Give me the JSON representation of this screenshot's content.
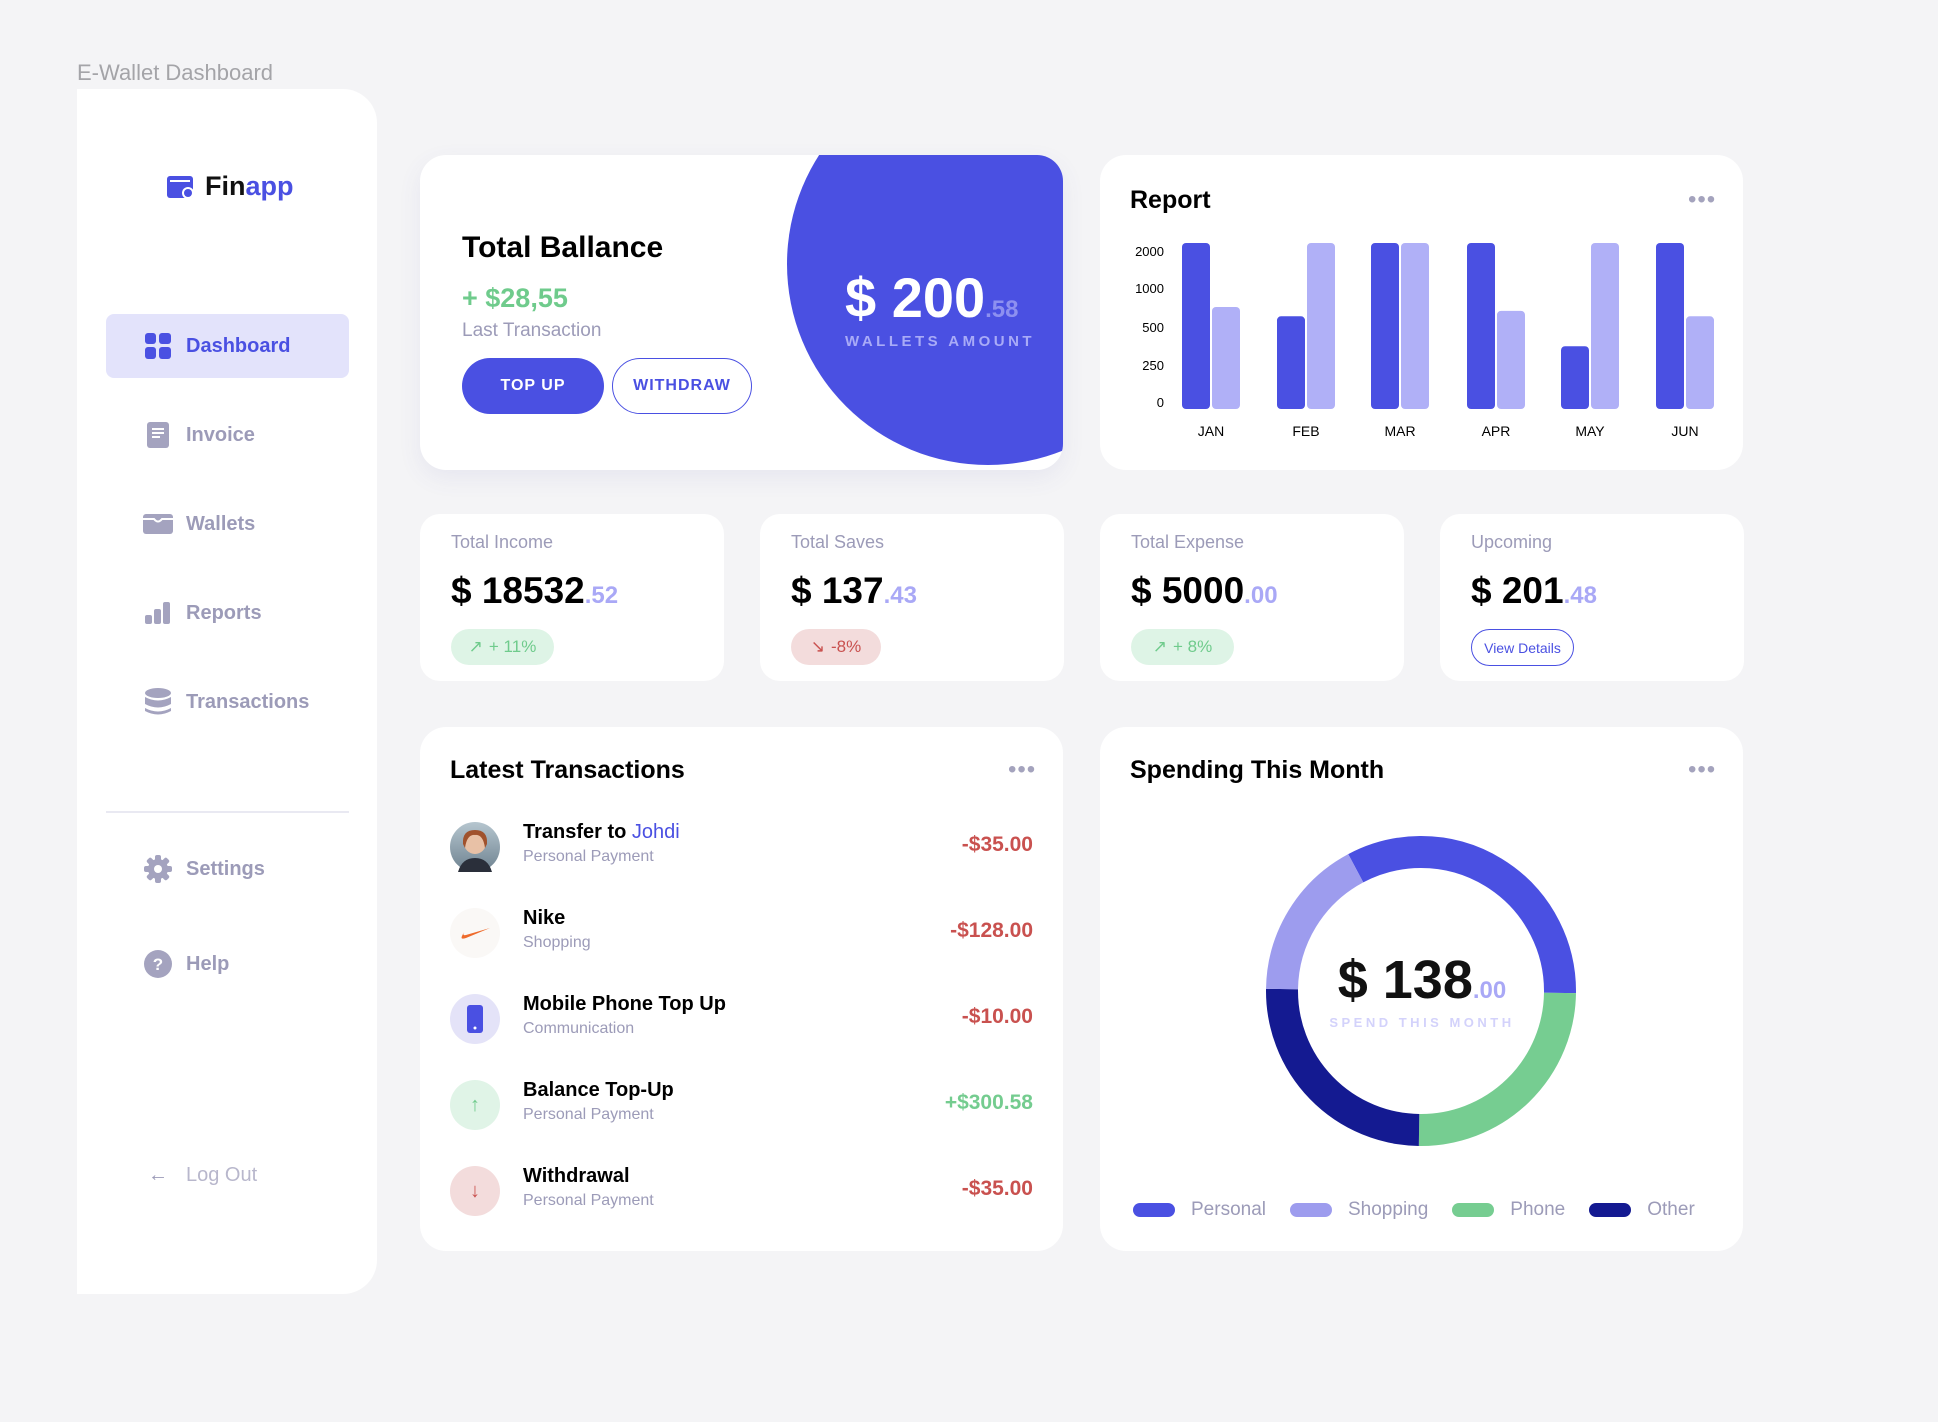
{
  "page_title": "E-Wallet Dashboard",
  "colors": {
    "primary": "#4a50e2",
    "light": "#b0b0f7",
    "green": "#74cc8f",
    "red": "#c9514f",
    "navy": "#141a91",
    "lavender": "#9d9cee"
  },
  "sidebar": {
    "logo": {
      "part1": "Fin",
      "part2": "app"
    },
    "items": [
      {
        "label": "Dashboard",
        "icon": "grid-icon",
        "active": true
      },
      {
        "label": "Invoice",
        "icon": "document-icon"
      },
      {
        "label": "Wallets",
        "icon": "wallet-icon"
      },
      {
        "label": "Reports",
        "icon": "bar-chart-icon"
      },
      {
        "label": "Transactions",
        "icon": "database-icon"
      }
    ],
    "bottom": [
      {
        "label": "Settings",
        "icon": "gear-icon"
      },
      {
        "label": "Help",
        "icon": "question-icon"
      }
    ],
    "logout": "Log Out"
  },
  "balance": {
    "title": "Total Ballance",
    "change": "+ $28,55",
    "change_label": "Last Transaction",
    "top_up": "TOP UP",
    "withdraw": "WITHDRAW",
    "amount": "$ 200",
    "cents": ".58",
    "amount_label": "WALLETS AMOUNT"
  },
  "report": {
    "title": "Report",
    "menu": "•••"
  },
  "chart_data": {
    "type": "bar",
    "title": "Report",
    "categories": [
      "JAN",
      "FEB",
      "MAR",
      "APR",
      "MAY",
      "JUN"
    ],
    "y_ticks": [
      2000,
      1000,
      500,
      250,
      0
    ],
    "ylim": [
      0,
      2000
    ],
    "y_scale": "non-linear (equally spaced ticks)",
    "grid": false,
    "series": [
      {
        "values": [
          2000,
          650,
          2000,
          2000,
          380,
          2000
        ],
        "color": "#4a50e2"
      },
      {
        "values": [
          770,
          2000,
          2000,
          720,
          2000,
          650
        ],
        "color": "#b0b0f7"
      }
    ]
  },
  "stats": [
    {
      "label": "Total Income",
      "amount": "$ 18532",
      "cents": ".52",
      "badge": "+ 11%",
      "trend": "up"
    },
    {
      "label": "Total Saves",
      "amount": "$ 137",
      "cents": ".43",
      "badge": "-8%",
      "trend": "down"
    },
    {
      "label": "Total Expense",
      "amount": "$ 5000",
      "cents": ".00",
      "badge": "+ 8%",
      "trend": "up"
    },
    {
      "label": "Upcoming",
      "amount": "$ 201",
      "cents": ".48",
      "button": "View Details"
    }
  ],
  "transactions": {
    "title": "Latest Transactions",
    "menu": "•••",
    "items": [
      {
        "title": "Transfer to",
        "highlight": "Johdi",
        "sub": "Personal Payment",
        "amount": "-$35.00",
        "type": "avatar"
      },
      {
        "title": "Nike",
        "sub": "Shopping",
        "amount": "-$128.00",
        "type": "nike"
      },
      {
        "title": "Mobile Phone Top Up",
        "sub": "Communication",
        "amount": "-$10.00",
        "type": "phone"
      },
      {
        "title": "Balance Top-Up",
        "sub": "Personal Payment",
        "amount": "+$300.58",
        "type": "up"
      },
      {
        "title": "Withdrawal",
        "sub": "Personal Payment",
        "amount": "-$35.00",
        "type": "down"
      }
    ]
  },
  "spending": {
    "title": "Spending This Month",
    "menu": "•••",
    "amount": "$ 138",
    "cents": ".00",
    "label": "SPEND THIS MONTH",
    "chart_data": {
      "type": "pie",
      "slices": [
        {
          "name": "Personal",
          "value": 33,
          "color": "#4a50e2"
        },
        {
          "name": "Phone",
          "value": 25,
          "color": "#76cd91"
        },
        {
          "name": "Other",
          "value": 25,
          "color": "#141a91"
        },
        {
          "name": "Shopping",
          "value": 17,
          "color": "#9d9cee"
        }
      ]
    },
    "legend": [
      "Personal",
      "Shopping",
      "Phone",
      "Other"
    ]
  }
}
